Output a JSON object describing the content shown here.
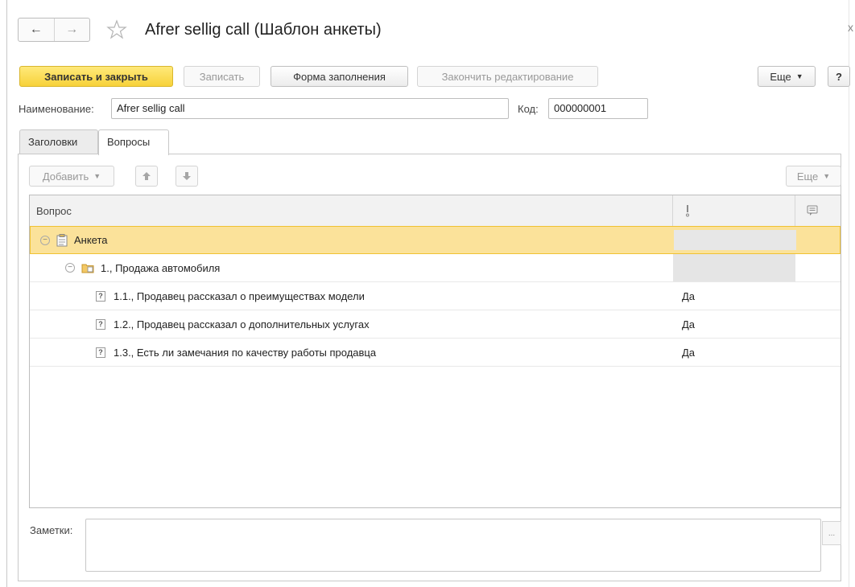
{
  "window": {
    "title": "Afrer sellig call (Шаблон анкеты)",
    "close_glyph": "x"
  },
  "nav": {
    "back_glyph": "←",
    "forward_glyph": "→"
  },
  "toolbar": {
    "save_close": "Записать и закрыть",
    "save": "Записать",
    "fill_form": "Форма заполнения",
    "finish_edit": "Закончить редактирование",
    "more": "Еще",
    "help": "?"
  },
  "fields": {
    "name_label": "Наименование:",
    "name_value": "Afrer sellig call",
    "code_label": "Код:",
    "code_value": "000000001"
  },
  "tabs": [
    {
      "label": "Заголовки",
      "active": false
    },
    {
      "label": "Вопросы",
      "active": true
    }
  ],
  "table_toolbar": {
    "add": "Добавить",
    "more": "Еще"
  },
  "table": {
    "columns": [
      "Вопрос",
      "required-icon",
      "comment-icon"
    ],
    "header_question": "Вопрос",
    "rows": [
      {
        "level": 0,
        "text": "Анкета",
        "icon": "questionnaire-icon",
        "value": "",
        "selected": true
      },
      {
        "level": 1,
        "text": "1., Продажа автомобиля",
        "icon": "folder-icon",
        "value": "",
        "selected": false
      },
      {
        "level": 2,
        "text": "1.1., Продавец рассказал о преимуществах модели",
        "icon": "question-icon",
        "value": "Да",
        "selected": false
      },
      {
        "level": 2,
        "text": "1.2., Продавец рассказал о дополнительных услугах",
        "icon": "question-icon",
        "value": "Да",
        "selected": false
      },
      {
        "level": 2,
        "text": "1.3., Есть ли замечания по качеству работы продавца",
        "icon": "question-icon",
        "value": "Да",
        "selected": false
      }
    ]
  },
  "notes": {
    "label": "Заметки:",
    "value": "",
    "dots": "..."
  },
  "colors": {
    "primary": "#f7d23a",
    "selected_row": "#fbe29a",
    "selected_border": "#f0c232"
  }
}
